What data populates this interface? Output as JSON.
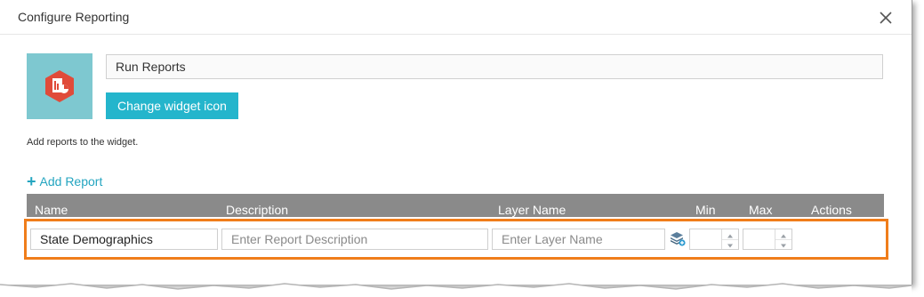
{
  "dialog": {
    "title": "Configure Reporting",
    "close_icon": "close-icon"
  },
  "widget": {
    "name_value": "Run Reports",
    "icon": "report-widget-icon",
    "icon_bg_color": "#7ec8d0",
    "change_icon_label": "Change widget icon"
  },
  "hint": "Add reports to the widget.",
  "add_report": {
    "plus": "+",
    "label": "Add Report",
    "color": "#24a5c0"
  },
  "table": {
    "columns": [
      "Name",
      "Description",
      "Layer Name",
      "Min",
      "Max",
      "Actions"
    ],
    "header_color": "#8a8a8a",
    "highlight_color": "#f07d1a",
    "rows": [
      {
        "name_value": "State Demographics",
        "description_placeholder": "Enter Report Description",
        "layer_placeholder": "Enter Layer Name",
        "layer_icon": "layer-select-icon",
        "min_value": "",
        "max_value": ""
      }
    ]
  }
}
